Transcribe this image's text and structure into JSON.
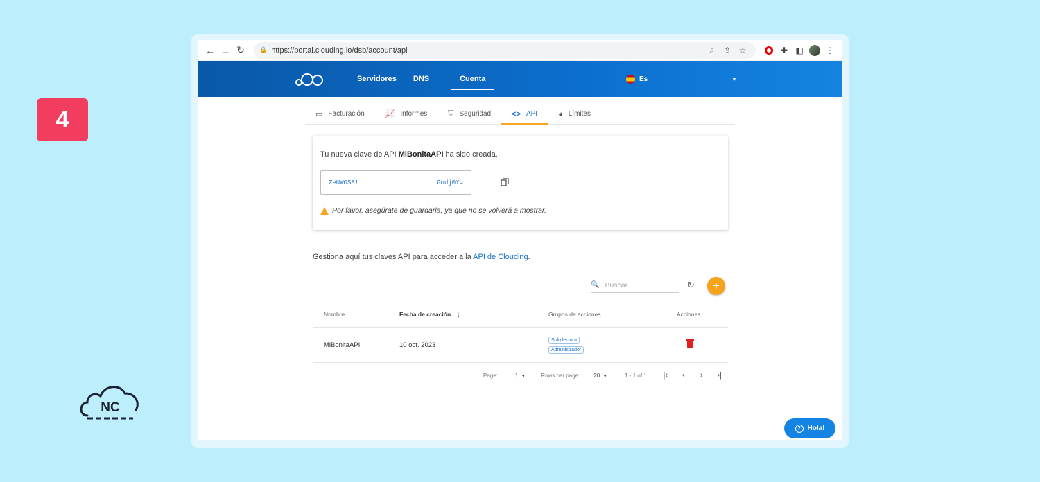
{
  "step_number": "4",
  "brand_logo_text": "NC",
  "browser": {
    "url": "https://portal.clouding.io/dsb/account/api"
  },
  "header": {
    "nav": [
      "Servidores",
      "DNS",
      "Cuenta"
    ],
    "active_nav": "Cuenta",
    "language": "Es"
  },
  "tabs": [
    {
      "label": "Facturación",
      "icon": "credit-card-icon"
    },
    {
      "label": "Informes",
      "icon": "line-chart-icon"
    },
    {
      "label": "Seguridad",
      "icon": "shield-icon"
    },
    {
      "label": "API",
      "icon": "code-icon"
    },
    {
      "label": "Límites",
      "icon": "pie-chart-icon"
    }
  ],
  "active_tab": "API",
  "key_card": {
    "msg_prefix": "Tu nueva clave de API ",
    "key_name": "MiBonitaAPI",
    "msg_suffix": " ha sido creada.",
    "key_start": "ZeUWOS8!",
    "key_end": "Godj0Y=",
    "warning": "Por favor, asegúrate de guardarla, ya que no se volverá a mostrar."
  },
  "manage": {
    "text": "Gestiona aquí tus claves API para acceder a la ",
    "link": "API de Clouding",
    "end": "."
  },
  "search": {
    "placeholder": "Buscar"
  },
  "table": {
    "headers": {
      "name": "Nombre",
      "date": "Fecha de creación",
      "groups": "Grupos de acciones",
      "actions": "Acciones"
    },
    "rows": [
      {
        "name": "MiBonitaAPI",
        "date": "10 oct. 2023",
        "groups": [
          "Solo lectura",
          "Administrador"
        ]
      }
    ]
  },
  "pagination": {
    "page_label": "Page:",
    "page_value": "1",
    "rows_label": "Rows per page:",
    "rows_value": "20",
    "range": "1 - 1 of 1"
  },
  "chat": {
    "label": "Hola!"
  },
  "colors": {
    "header_blue": "#0c6fce",
    "accent_orange": "#f7a21b",
    "link_blue": "#1a6fc9",
    "badge_pink": "#f23d5e"
  }
}
